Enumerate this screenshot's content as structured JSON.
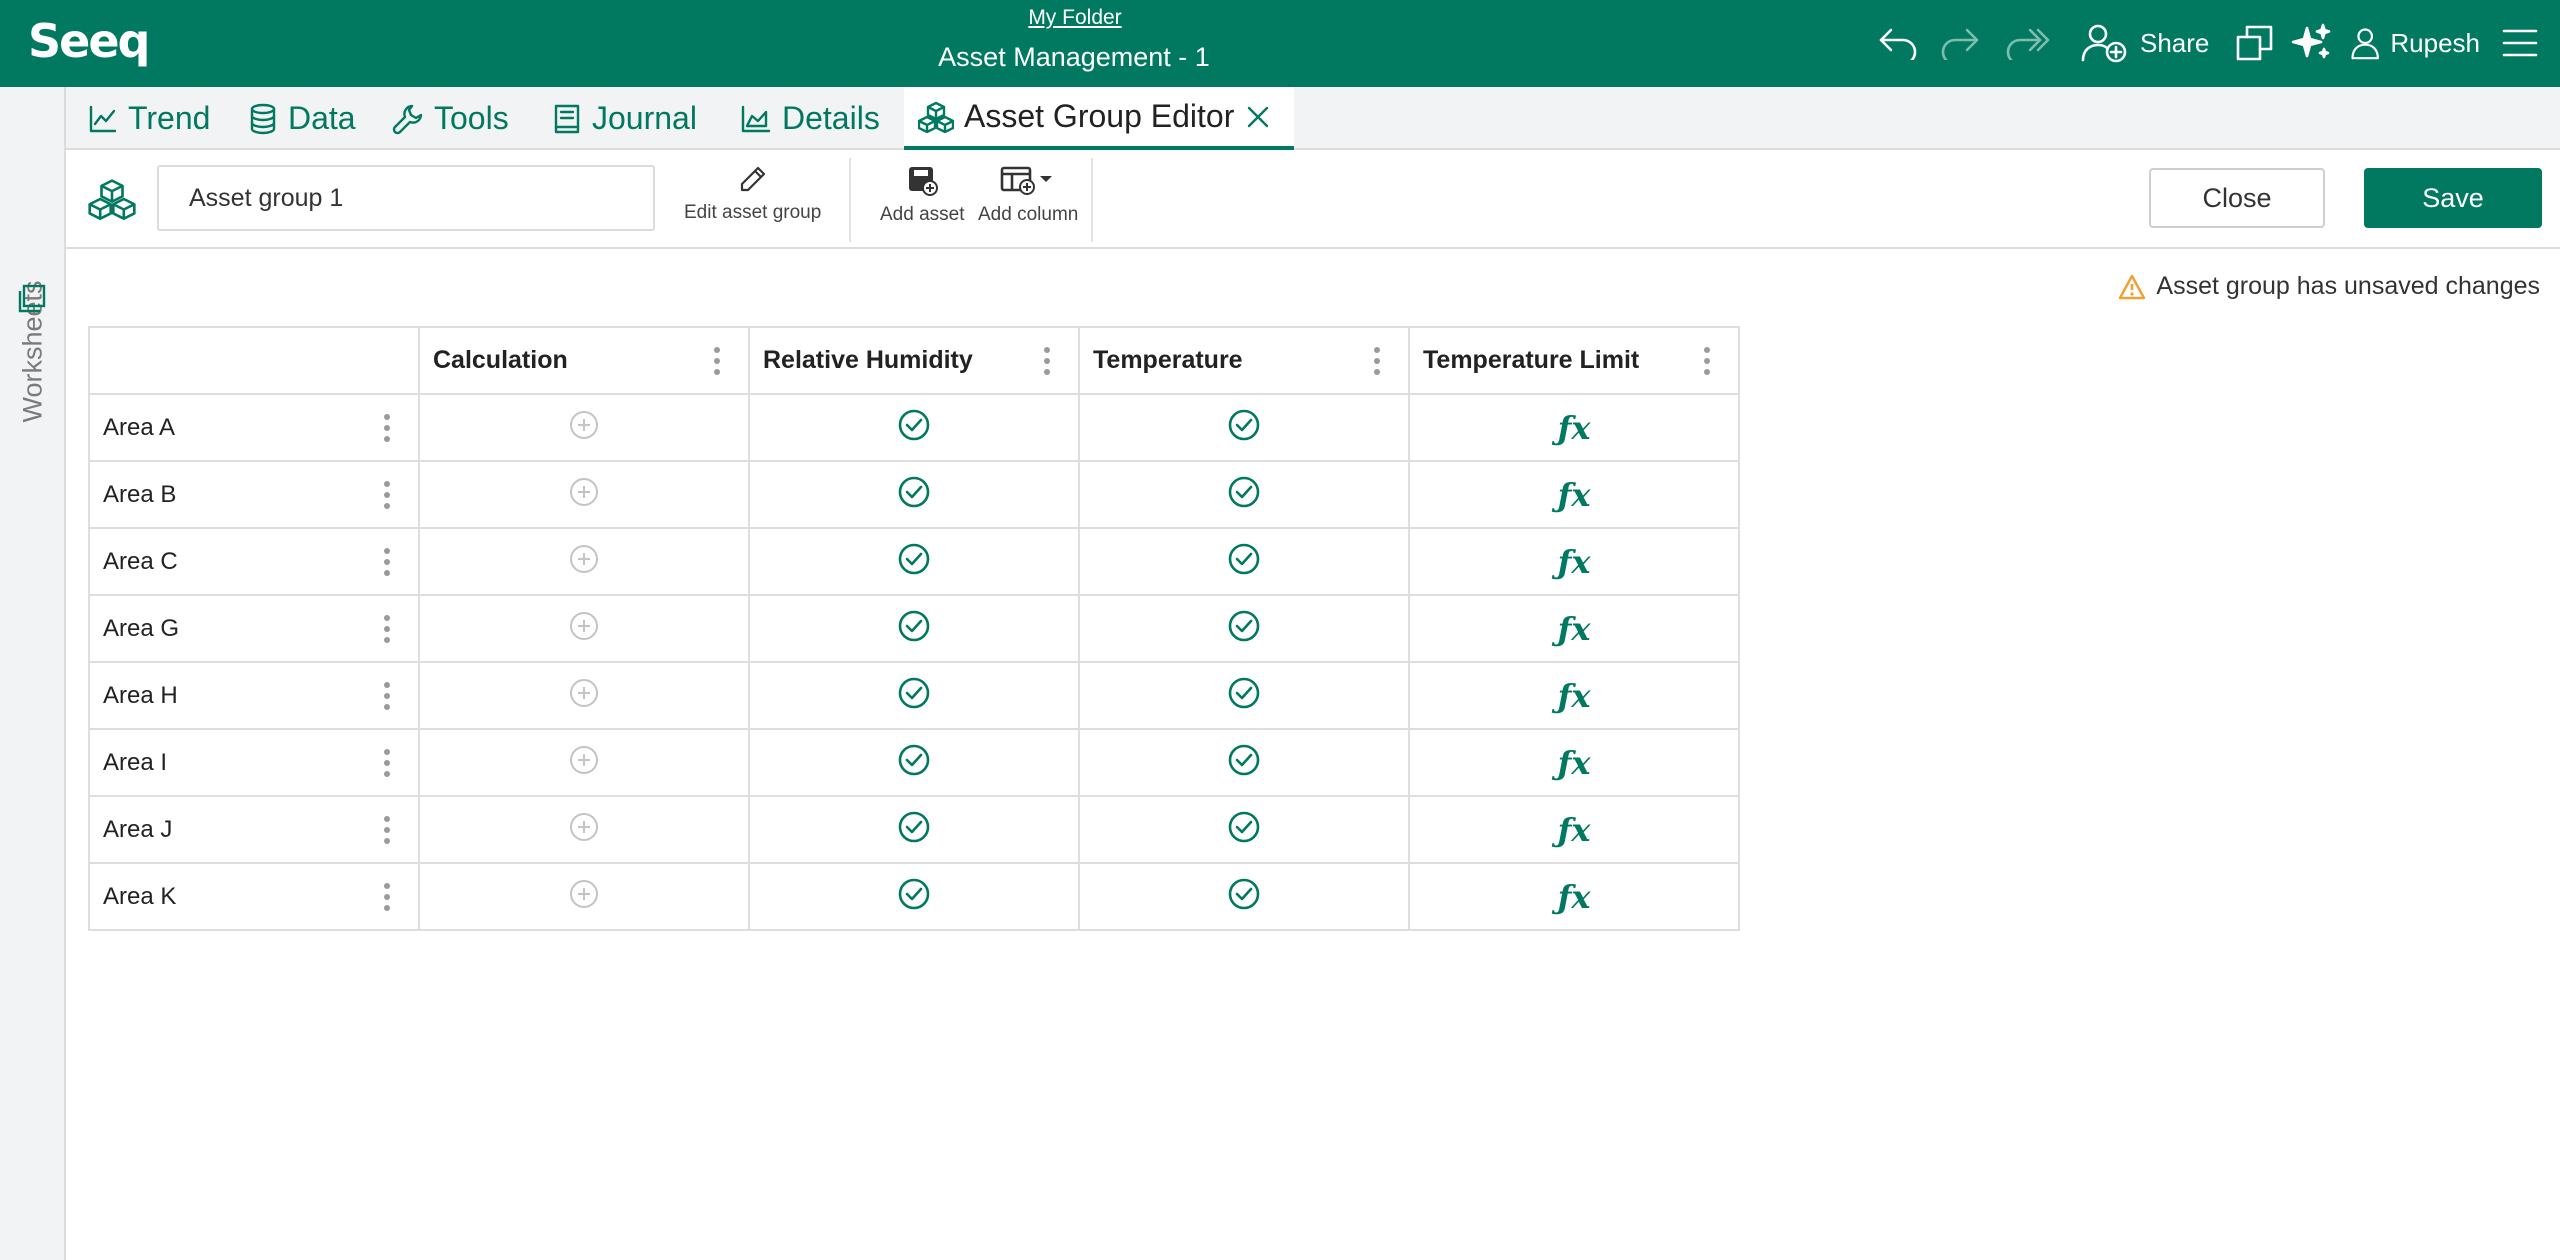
{
  "header": {
    "logo": "Seeq",
    "folder_link": "My Folder",
    "workbook_title": "Asset Management - 1",
    "share_label": "Share",
    "user_name": "Rupesh",
    "icons": [
      "undo-icon",
      "redo-icon",
      "redo-all-icon",
      "add-user-icon",
      "worksheet-copy-icon",
      "sparkle-icon",
      "user-icon",
      "hamburger-menu-icon"
    ]
  },
  "sidebar": {
    "worksheets_label": "Worksheets"
  },
  "tabs": [
    {
      "label": "Trend",
      "icon": "trend-icon"
    },
    {
      "label": "Data",
      "icon": "database-icon"
    },
    {
      "label": "Tools",
      "icon": "wrench-icon"
    },
    {
      "label": "Journal",
      "icon": "journal-icon"
    },
    {
      "label": "Details",
      "icon": "area-chart-icon"
    },
    {
      "label": "Asset Group Editor",
      "icon": "cubes-icon",
      "active": true
    }
  ],
  "toolbar": {
    "asset_group_name": "Asset group 1",
    "edit_asset_group": "Edit asset group",
    "add_asset": "Add asset",
    "add_column": "Add column",
    "close": "Close",
    "save": "Save"
  },
  "warning": {
    "text": "Asset group has unsaved changes",
    "color": "#f0a030"
  },
  "table": {
    "columns": [
      "",
      "Calculation",
      "Relative Humidity",
      "Temperature",
      "Temperature Limit"
    ],
    "rows": [
      {
        "name": "Area A",
        "cells": [
          "add",
          "check",
          "check",
          "fx"
        ]
      },
      {
        "name": "Area B",
        "cells": [
          "add",
          "check",
          "check",
          "fx"
        ]
      },
      {
        "name": "Area C",
        "cells": [
          "add",
          "check",
          "check",
          "fx"
        ]
      },
      {
        "name": "Area G",
        "cells": [
          "add",
          "check",
          "check",
          "fx"
        ]
      },
      {
        "name": "Area H",
        "cells": [
          "add",
          "check",
          "check",
          "fx"
        ]
      },
      {
        "name": "Area I",
        "cells": [
          "add",
          "check",
          "check",
          "fx"
        ]
      },
      {
        "name": "Area J",
        "cells": [
          "add",
          "check",
          "check",
          "fx"
        ]
      },
      {
        "name": "Area K",
        "cells": [
          "add",
          "check",
          "check",
          "fx"
        ]
      }
    ],
    "fx_symbol": "ƒx"
  },
  "colors": {
    "brand": "#007960",
    "rail": "#f2f3f4"
  }
}
